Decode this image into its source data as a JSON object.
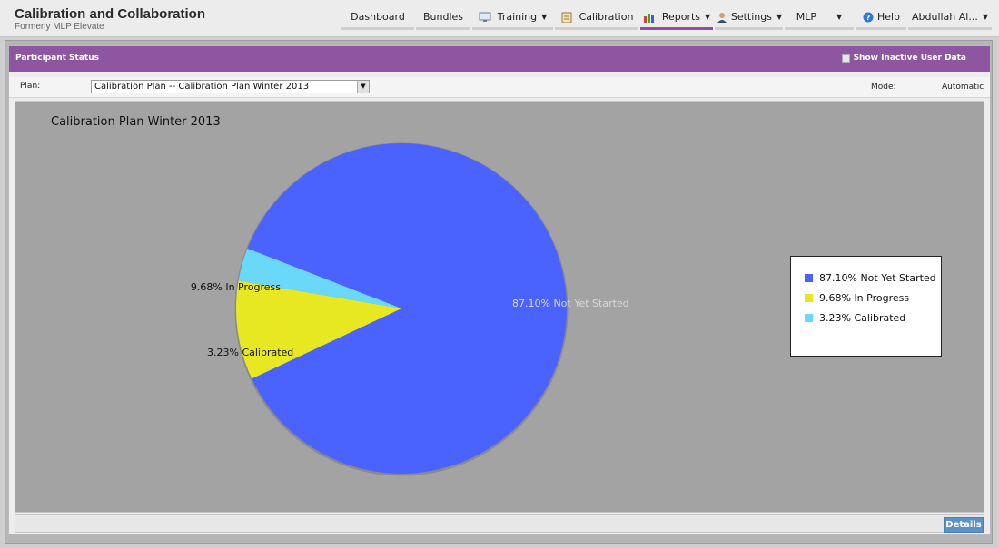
{
  "app": {
    "title": "Calibration and Collaboration",
    "subtitle": "Formerly MLP Elevate"
  },
  "nav": {
    "dashboard": "Dashboard",
    "bundles": "Bundles",
    "training": "Training",
    "calibration": "Calibration",
    "reports": "Reports",
    "settings": "Settings",
    "mlp": "MLP",
    "help": "Help",
    "user": "Abdullah Al...",
    "active_item": "Reports"
  },
  "panel": {
    "title": "Participant Status",
    "inactive_label": "Show Inactive User Data",
    "inactive_checked": false,
    "plan_label": "Plan:",
    "plan_value": "Calibration Plan -- Calibration Plan Winter 2013",
    "mode_label": "Mode:",
    "mode_value": "Automatic",
    "details_button": "Details"
  },
  "colors": {
    "accent_purple": "#8e56a0",
    "button_blue": "#5e92c7",
    "chart_background": "#a3a3a3"
  },
  "chart_data": {
    "type": "pie",
    "title": "Calibration Plan Winter 2013",
    "slices": [
      {
        "label": "Not Yet Started",
        "value": 87.1,
        "display": "87.10% Not Yet Started",
        "color": "#4a63ff"
      },
      {
        "label": "In Progress",
        "value": 9.68,
        "display": "9.68% In Progress",
        "color": "#e8e822"
      },
      {
        "label": "Calibrated",
        "value": 3.23,
        "display": "3.23% Calibrated",
        "color": "#6ad8f8"
      }
    ],
    "legend_position": "right"
  }
}
